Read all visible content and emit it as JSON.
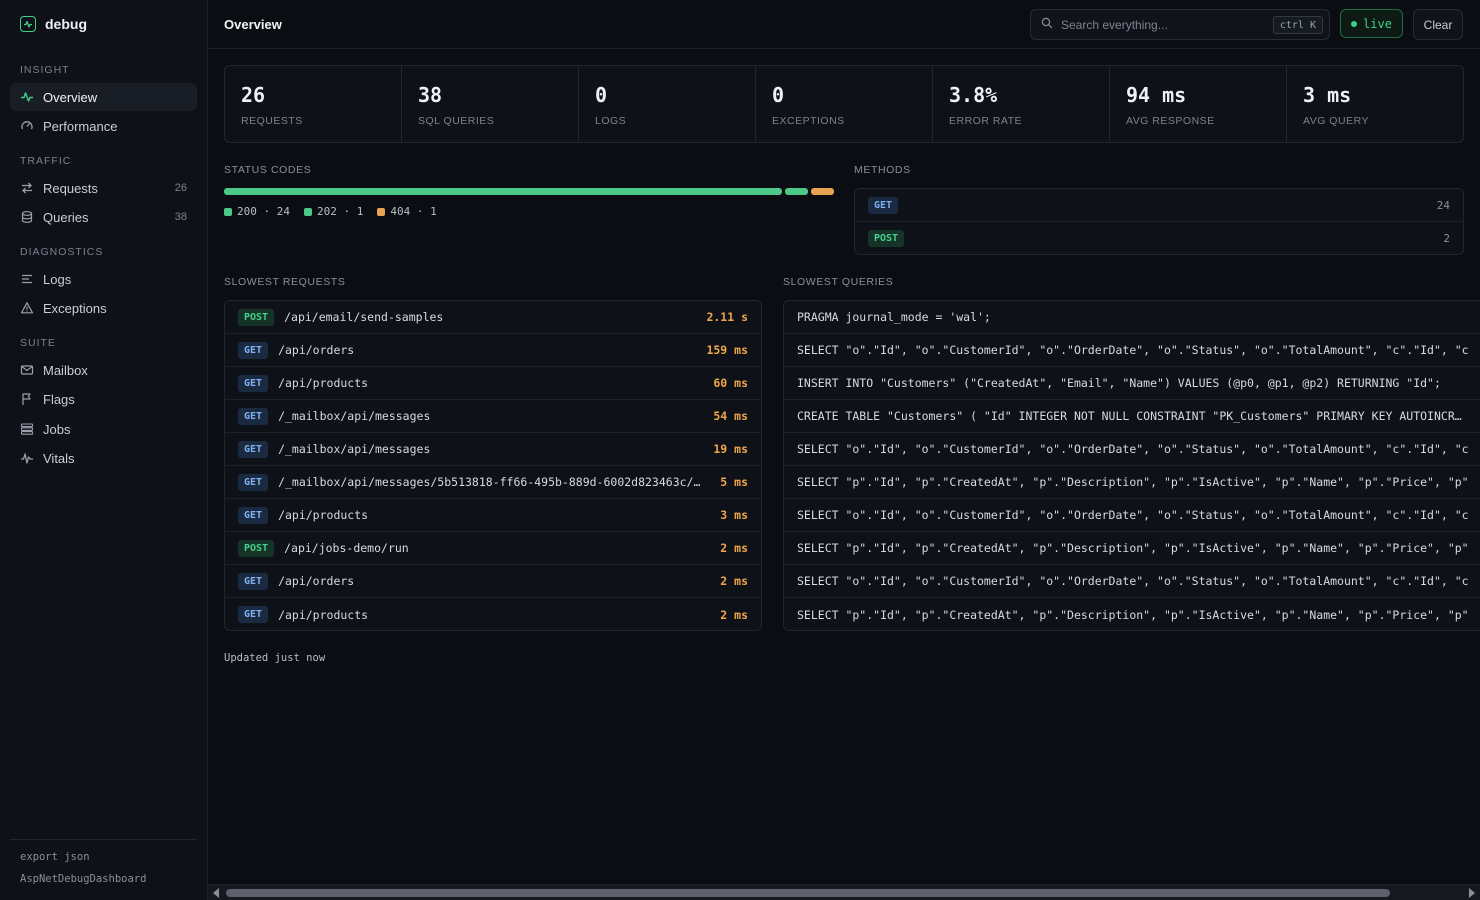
{
  "brand": {
    "name": "debug",
    "icon": "pulse-icon"
  },
  "sidebar": {
    "sections": [
      {
        "title": "INSIGHT",
        "items": [
          {
            "label": "Overview",
            "icon": "activity-icon",
            "count": ""
          },
          {
            "label": "Performance",
            "icon": "gauge-icon",
            "count": ""
          }
        ]
      },
      {
        "title": "TRAFFIC",
        "items": [
          {
            "label": "Requests",
            "icon": "arrows-exchange-icon",
            "count": "26"
          },
          {
            "label": "Queries",
            "icon": "database-icon",
            "count": "38"
          }
        ]
      },
      {
        "title": "DIAGNOSTICS",
        "items": [
          {
            "label": "Logs",
            "icon": "lines-icon",
            "count": ""
          },
          {
            "label": "Exceptions",
            "icon": "warning-triangle-icon",
            "count": ""
          }
        ]
      },
      {
        "title": "SUITE",
        "items": [
          {
            "label": "Mailbox",
            "icon": "mail-icon",
            "count": ""
          },
          {
            "label": "Flags",
            "icon": "flag-icon",
            "count": ""
          },
          {
            "label": "Jobs",
            "icon": "stack-icon",
            "count": ""
          },
          {
            "label": "Vitals",
            "icon": "heartbeat-icon",
            "count": ""
          }
        ]
      }
    ],
    "footer": {
      "export": "export json",
      "app": "AspNetDebugDashboard"
    }
  },
  "topbar": {
    "title": "Overview",
    "search_placeholder": "Search everything...",
    "search_shortcut": "ctrl K",
    "live_label": "live",
    "clear_label": "Clear"
  },
  "stats": [
    {
      "value": "26",
      "label": "REQUESTS"
    },
    {
      "value": "38",
      "label": "SQL QUERIES"
    },
    {
      "value": "0",
      "label": "LOGS"
    },
    {
      "value": "0",
      "label": "EXCEPTIONS"
    },
    {
      "value": "3.8%",
      "label": "ERROR RATE"
    },
    {
      "value": "94 ms",
      "label": "AVG RESPONSE"
    },
    {
      "value": "3 ms",
      "label": "AVG QUERY"
    }
  ],
  "status_codes": {
    "title": "STATUS CODES",
    "codes": [
      {
        "code": "200",
        "count": 24,
        "text": "200 · 24",
        "color": "#4cc988"
      },
      {
        "code": "202",
        "count": 1,
        "text": "202 · 1",
        "color": "#4cc988"
      },
      {
        "code": "404",
        "count": 1,
        "text": "404 · 1",
        "color": "#e8a350"
      }
    ]
  },
  "methods": {
    "title": "METHODS",
    "rows": [
      {
        "method": "GET",
        "count": "24"
      },
      {
        "method": "POST",
        "count": "2"
      }
    ]
  },
  "slowest_requests": {
    "title": "SLOWEST REQUESTS",
    "rows": [
      {
        "method": "POST",
        "path": "/api/email/send-samples",
        "duration": "2.11 s"
      },
      {
        "method": "GET",
        "path": "/api/orders",
        "duration": "159 ms"
      },
      {
        "method": "GET",
        "path": "/api/products",
        "duration": "60 ms"
      },
      {
        "method": "GET",
        "path": "/_mailbox/api/messages",
        "duration": "54 ms"
      },
      {
        "method": "GET",
        "path": "/_mailbox/api/messages",
        "duration": "19 ms"
      },
      {
        "method": "GET",
        "path": "/_mailbox/api/messages/5b513818-ff66-495b-889d-6002d823463c/…",
        "duration": "5 ms"
      },
      {
        "method": "GET",
        "path": "/api/products",
        "duration": "3 ms"
      },
      {
        "method": "POST",
        "path": "/api/jobs-demo/run",
        "duration": "2 ms"
      },
      {
        "method": "GET",
        "path": "/api/orders",
        "duration": "2 ms"
      },
      {
        "method": "GET",
        "path": "/api/products",
        "duration": "2 ms"
      }
    ]
  },
  "slowest_queries": {
    "title": "SLOWEST QUERIES",
    "rows": [
      "PRAGMA journal_mode = 'wal';",
      "SELECT \"o\".\"Id\", \"o\".\"CustomerId\", \"o\".\"OrderDate\", \"o\".\"Status\", \"o\".\"TotalAmount\", \"c\".\"Id\", \"c",
      "INSERT INTO \"Customers\" (\"CreatedAt\", \"Email\", \"Name\") VALUES (@p0, @p1, @p2) RETURNING \"Id\";",
      "CREATE TABLE \"Customers\" ( \"Id\" INTEGER NOT NULL CONSTRAINT \"PK_Customers\" PRIMARY KEY AUTOINCR…",
      "SELECT \"o\".\"Id\", \"o\".\"CustomerId\", \"o\".\"OrderDate\", \"o\".\"Status\", \"o\".\"TotalAmount\", \"c\".\"Id\", \"c",
      "SELECT \"p\".\"Id\", \"p\".\"CreatedAt\", \"p\".\"Description\", \"p\".\"IsActive\", \"p\".\"Name\", \"p\".\"Price\", \"p\"",
      "SELECT \"o\".\"Id\", \"o\".\"CustomerId\", \"o\".\"OrderDate\", \"o\".\"Status\", \"o\".\"TotalAmount\", \"c\".\"Id\", \"c",
      "SELECT \"p\".\"Id\", \"p\".\"CreatedAt\", \"p\".\"Description\", \"p\".\"IsActive\", \"p\".\"Name\", \"p\".\"Price\", \"p\"",
      "SELECT \"o\".\"Id\", \"o\".\"CustomerId\", \"o\".\"OrderDate\", \"o\".\"Status\", \"o\".\"TotalAmount\", \"c\".\"Id\", \"c",
      "SELECT \"p\".\"Id\", \"p\".\"CreatedAt\", \"p\".\"Description\", \"p\".\"IsActive\", \"p\".\"Name\", \"p\".\"Price\", \"p\""
    ]
  },
  "footer_status": "Updated just now"
}
